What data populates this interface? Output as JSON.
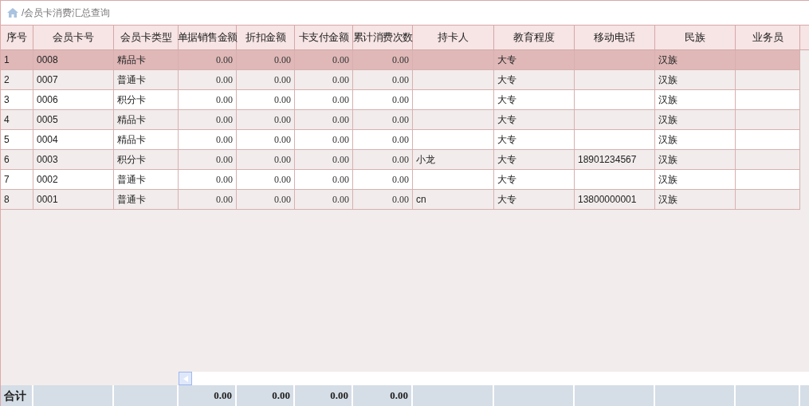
{
  "breadcrumb": "/会员卡消费汇总查询",
  "columns": [
    "序号",
    "会员卡号",
    "会员卡类型",
    "单据销售金额",
    "折扣金额",
    "卡支付金额",
    "累计消费次数",
    "持卡人",
    "教育程度",
    "移动电话",
    "民族",
    "业务员"
  ],
  "rows": [
    {
      "selected": true,
      "no": "1",
      "card_no": "0008",
      "card_type": "精品卡",
      "sales": "0.00",
      "discount": "0.00",
      "card_pay": "0.00",
      "visits": "0.00",
      "education": "大专",
      "ethnicity": "汉族"
    },
    {
      "selected": false,
      "no": "2",
      "card_no": "0007",
      "card_type": "普通卡",
      "sales": "0.00",
      "discount": "0.00",
      "card_pay": "0.00",
      "visits": "0.00",
      "education": "大专",
      "ethnicity": "汉族"
    },
    {
      "selected": false,
      "no": "3",
      "card_no": "0006",
      "card_type": "积分卡",
      "sales": "0.00",
      "discount": "0.00",
      "card_pay": "0.00",
      "visits": "0.00",
      "education": "大专",
      "ethnicity": "汉族"
    },
    {
      "selected": false,
      "no": "4",
      "card_no": "0005",
      "card_type": "精品卡",
      "sales": "0.00",
      "discount": "0.00",
      "card_pay": "0.00",
      "visits": "0.00",
      "education": "大专",
      "ethnicity": "汉族"
    },
    {
      "selected": false,
      "no": "5",
      "card_no": "0004",
      "card_type": "精品卡",
      "sales": "0.00",
      "discount": "0.00",
      "card_pay": "0.00",
      "visits": "0.00",
      "education": "大专",
      "ethnicity": "汉族"
    },
    {
      "selected": false,
      "no": "6",
      "card_no": "0003",
      "card_type": "积分卡",
      "sales": "0.00",
      "discount": "0.00",
      "card_pay": "0.00",
      "visits": "0.00",
      "holder": "小龙",
      "education": "大专",
      "mobile": "18901234567",
      "ethnicity": "汉族"
    },
    {
      "selected": false,
      "no": "7",
      "card_no": "0002",
      "card_type": "普通卡",
      "sales": "0.00",
      "discount": "0.00",
      "card_pay": "0.00",
      "visits": "0.00",
      "education": "大专",
      "ethnicity": "汉族"
    },
    {
      "selected": false,
      "no": "8",
      "card_no": "0001",
      "card_type": "普通卡",
      "sales": "0.00",
      "discount": "0.00",
      "card_pay": "0.00",
      "visits": "0.00",
      "holder": "cn",
      "education": "大专",
      "mobile": "13800000001",
      "ethnicity": "汉族"
    }
  ],
  "footer": {
    "no": "合计",
    "sales": "0.00",
    "discount": "0.00",
    "card_pay": "0.00",
    "visits": "0.00"
  }
}
